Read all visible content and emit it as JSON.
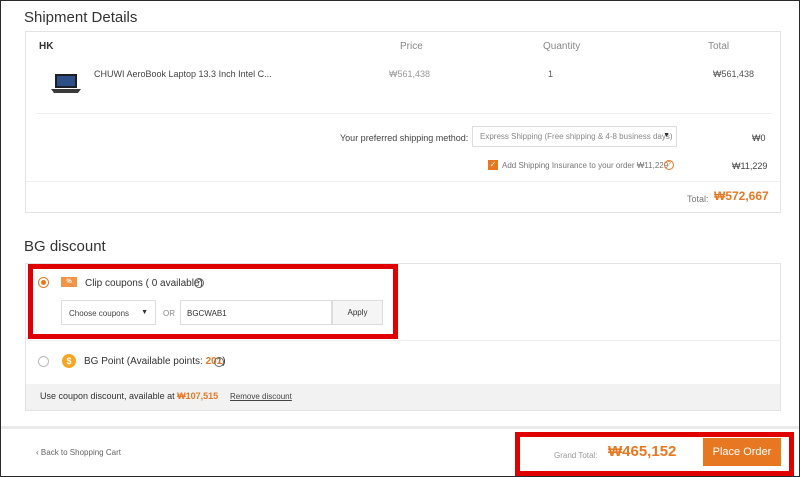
{
  "shipment": {
    "title": "Shipment Details",
    "warehouse": "HK",
    "columns": {
      "price": "Price",
      "quantity": "Quantity",
      "total": "Total"
    },
    "product": {
      "name": "CHUWI AeroBook Laptop 13.3 Inch Intel C...",
      "price": "₩561,438",
      "quantity": "1",
      "total": "₩561,438"
    },
    "shipping_method_label": "Your preferred shipping method:",
    "shipping_method_value": "Express Shipping (Free shipping & 4-8 business days)",
    "shipping_cost": "₩0",
    "insurance_label": "Add Shipping Insurance to your order  ₩11,229",
    "insurance_checked": true,
    "insurance_cost": "₩11,229",
    "total_label": "Total:",
    "total_value": "₩572,667"
  },
  "discount": {
    "title": "BG discount",
    "coupon_icon_text": "%",
    "clip_label": "Clip coupons ( 0 available)",
    "coupon_select_value": "Choose coupons",
    "or_label": "OR",
    "code_value": "BGCWAB1",
    "apply_label": "Apply",
    "point_icon_text": "$",
    "point_label_prefix": "BG Point (Available points: ",
    "point_value": "201",
    "point_label_suffix": ")",
    "note_prefix": "Use coupon discount, available at ",
    "note_value": "₩107,515",
    "remove_label": "Remove discount"
  },
  "footer": {
    "back_label": "Back to Shopping Cart",
    "grand_total_label": "Grand Total:",
    "grand_total_value": "₩465,152",
    "place_order_label": "Place Order"
  },
  "colors": {
    "accent": "#e87722",
    "highlight": "#e00000"
  }
}
